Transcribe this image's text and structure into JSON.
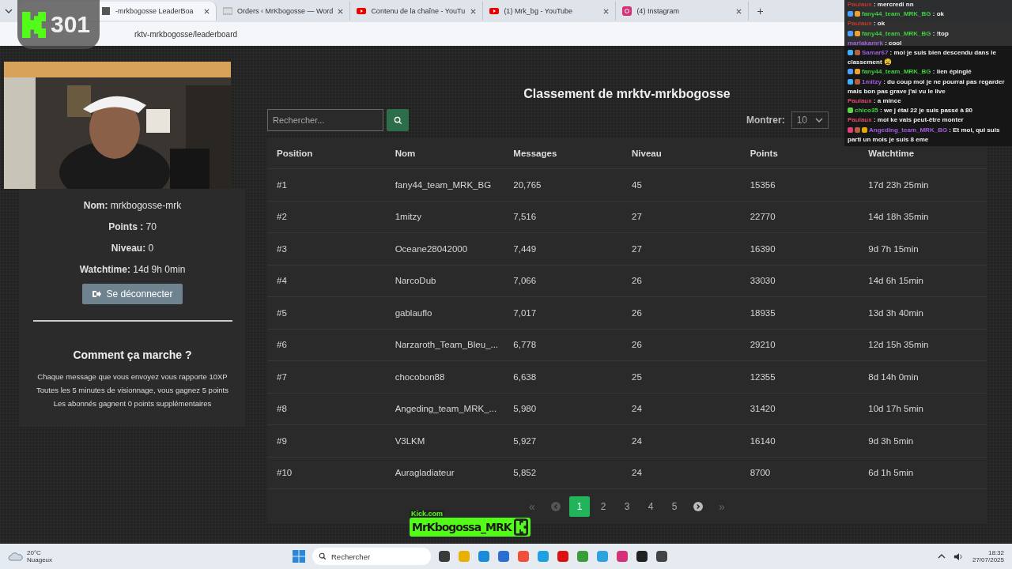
{
  "browser": {
    "tabs": [
      {
        "title": "-mrkbogosse LeaderBoa",
        "kind": "page",
        "selected": true
      },
      {
        "title": "Orders ‹ MrKbogosse — Word",
        "kind": "wordpress",
        "selected": false
      },
      {
        "title": "Contenu de la chaîne - YouTu",
        "kind": "youtube",
        "selected": false
      },
      {
        "title": "(1) Mrk_bg - YouTube",
        "kind": "youtube",
        "selected": false
      },
      {
        "title": "(4) Instagram",
        "kind": "instagram",
        "selected": false
      }
    ],
    "new_tab": "+",
    "url": "rktv-mrkbogosse/leaderboard"
  },
  "profile": {
    "lines": [
      "**Nom:** mrkbogosse-mrk",
      "**Points :** 70",
      "**Niveau:** 0",
      "**Watchtime:** 14d 9h 0min"
    ],
    "logout": "Se déconnecter"
  },
  "how_it_works": {
    "title": "Comment ça marche ?",
    "lines": [
      "Chaque message que vous envoyez vous rapporte 10XP",
      "Toutes les 5 minutes de visionnage, vous gagnez 5 points",
      "Les abonnés gagnent 0 points supplémentaires"
    ]
  },
  "leaderboard": {
    "title": "Classement de mrktv-mrkbogosse",
    "search": {
      "placeholder": "Rechercher..."
    },
    "show": {
      "label": "Montrer:",
      "value": "10"
    },
    "columns": [
      "Position",
      "Nom",
      "Messages",
      "Niveau",
      "Points",
      "Watchtime"
    ],
    "rows": [
      [
        "#1",
        "fany44_team_MRK_BG",
        "20,765",
        "45",
        "15356",
        "17d 23h 25min"
      ],
      [
        "#2",
        "1mitzy",
        "7,516",
        "27",
        "22770",
        "14d 18h 35min"
      ],
      [
        "#3",
        "Oceane28042000",
        "7,449",
        "27",
        "16390",
        "9d 7h 15min"
      ],
      [
        "#4",
        "NarcoDub",
        "7,066",
        "26",
        "33030",
        "14d 6h 15min"
      ],
      [
        "#5",
        "gablauflo",
        "7,017",
        "26",
        "18935",
        "13d 3h 40min"
      ],
      [
        "#6",
        "Narzaroth_Team_Bleu_...",
        "6,778",
        "26",
        "29210",
        "12d 15h 35min"
      ],
      [
        "#7",
        "chocobon88",
        "6,638",
        "25",
        "12355",
        "8d 14h 0min"
      ],
      [
        "#8",
        "Angeding_team_MRK_...",
        "5,980",
        "24",
        "31420",
        "10d 17h 5min"
      ],
      [
        "#9",
        "V3LKM",
        "5,927",
        "24",
        "16140",
        "9d 3h 5min"
      ],
      [
        "#10",
        "Auragladiateur",
        "5,852",
        "24",
        "8700",
        "6d 1h 5min"
      ]
    ],
    "pagination": [
      {
        "kind": "first",
        "label": "«",
        "selected": false
      },
      {
        "kind": "prev",
        "selected": false
      },
      {
        "kind": "page",
        "label": "1",
        "selected": true
      },
      {
        "kind": "page",
        "label": "2",
        "selected": false
      },
      {
        "kind": "page",
        "label": "3",
        "selected": false
      },
      {
        "kind": "page",
        "label": "4",
        "selected": false
      },
      {
        "kind": "page",
        "label": "5",
        "selected": false
      },
      {
        "kind": "next",
        "selected": false
      },
      {
        "kind": "last",
        "label": "»",
        "selected": false
      }
    ]
  },
  "chat": [
    {
      "user": "Paulaux",
      "color": "#c0392b",
      "text": ": mercredi nn"
    },
    {
      "user": "fany44_team_MRK_BG",
      "color": "#3fcf3f",
      "badges": [
        {
          "color": "#4aa3ff"
        },
        {
          "color": "#f0a030"
        }
      ],
      "text": ": ok"
    },
    {
      "user": "Paulaux",
      "color": "#c0392b",
      "text": ": ok"
    },
    {
      "user": "fany44_team_MRK_BG",
      "color": "#3fcf3f",
      "badges": [
        {
          "color": "#4aa3ff"
        },
        {
          "color": "#f0a030"
        }
      ],
      "text": ": !top"
    },
    {
      "user": "marlakamrk",
      "color": "#a05ee0",
      "text": ": cool"
    },
    {
      "user": "Samar67",
      "color": "#a05ee0",
      "badges": [
        {
          "color": "#3fb0ff"
        },
        {
          "color": "#b06040"
        }
      ],
      "text": ": moi je suis bien descendu dans le classement 😩"
    },
    {
      "user": "fany44_team_MRK_BG",
      "color": "#3fcf3f",
      "badges": [
        {
          "color": "#4aa3ff"
        },
        {
          "color": "#f0a030"
        }
      ],
      "text": ": lien épinglé"
    },
    {
      "user": "1mitzy",
      "color": "#a05ee0",
      "badges": [
        {
          "color": "#3fb0ff"
        },
        {
          "color": "#b06040"
        }
      ],
      "text": ": du coup moi je ne pourrai pas regarder mais bon pas grave j'ai vu le live"
    },
    {
      "user": "Paulaux",
      "color": "#d94a6a",
      "text": ": a mince"
    },
    {
      "user": "chico35",
      "color": "#3fcf3f",
      "badges": [
        {
          "color": "#5fd34a"
        }
      ],
      "text": ": we j étai 22 je suis passé à 80"
    },
    {
      "user": "Paulaux",
      "color": "#d94a6a",
      "text": ": moi ke vais peut-être monter"
    },
    {
      "user": "Angeding_team_MRK_BG",
      "color": "#a05ee0",
      "badges": [
        {
          "color": "#e0407a"
        },
        {
          "color": "#b06040"
        },
        {
          "color": "#e8a800"
        }
      ],
      "text": ": Et moi, qui suis parti un mois je suis 8 eme"
    }
  ],
  "stream_overlay": {
    "counter": "301",
    "site": "Kick.com",
    "channel": "MrKbogossa_MRK"
  },
  "taskbar": {
    "temperature": "20°C",
    "weather": "Nuageux",
    "search": "Rechercher",
    "time": "18:32",
    "date": "27/07/2025"
  }
}
